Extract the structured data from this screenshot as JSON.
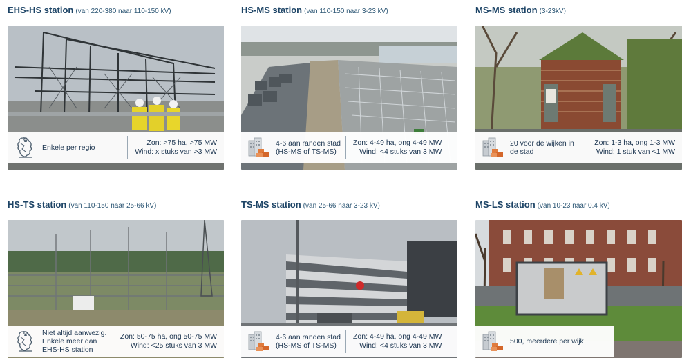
{
  "stations": [
    {
      "name": "EHS-HS station",
      "range": "(van 220-380 naar 110-150 kV)",
      "count": "Enkele per regio",
      "count_icon": "map-icon",
      "zon": "Zon: >75 ha, >75 MW",
      "wind": "Wind: x stuks van >3 MW"
    },
    {
      "name": "HS-MS station",
      "range": "(van 110-150 naar 3-23 kV)",
      "count": "4-6 aan randen stad (HS-MS of TS-MS)",
      "count_icon": "city-icon",
      "zon": "Zon: 4-49 ha, ong 4-49 MW",
      "wind": "Wind: <4 stuks van 3 MW"
    },
    {
      "name": "MS-MS station",
      "range": "(3-23kV)",
      "count": "20 voor de wijken in de stad",
      "count_icon": "city-icon",
      "zon": "Zon: 1-3 ha, ong 1-3 MW",
      "wind": "Wind: 1 stuk van <1 MW"
    },
    {
      "name": "HS-TS station",
      "range": "(van 110-150 naar 25-66 kV)",
      "count": "Niet altijd aanwezig. Enkele meer dan EHS-HS station",
      "count_icon": "map-icon",
      "zon": "Zon: 50-75 ha, ong 50-75 MW",
      "wind": "Wind: <25 stuks van 3 MW"
    },
    {
      "name": "TS-MS station",
      "range": "(van 25-66 naar 3-23 kV)",
      "count": "4-6 aan randen stad (HS-MS of TS-MS)",
      "count_icon": "city-icon",
      "zon": "Zon: 4-49 ha, ong 4-49 MW",
      "wind": "Wind: <4 stuks van 3 MW"
    },
    {
      "name": "MS-LS station",
      "range": "(van 10-23 naar 0.4 kV)",
      "count": "500, meerdere per wijk",
      "count_icon": "city-icon",
      "zon": "",
      "wind": ""
    }
  ]
}
